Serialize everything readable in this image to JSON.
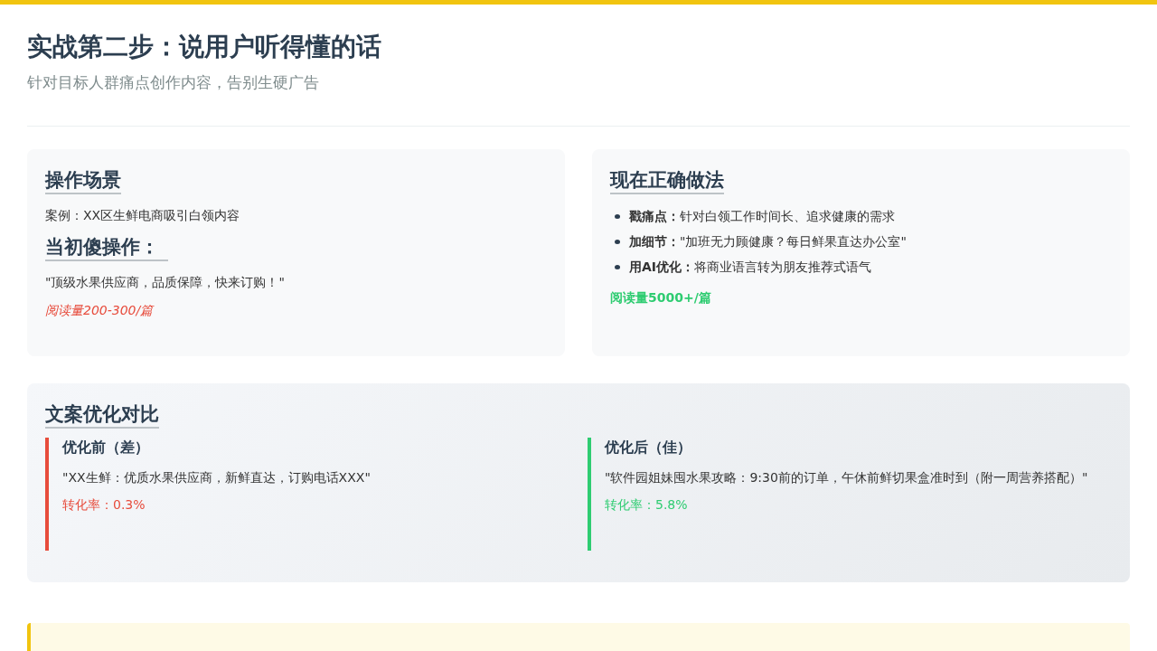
{
  "header": {
    "title": "实战第二步：说用户听得懂的话",
    "subtitle": "针对目标人群痛点创作内容，告别生硬广告"
  },
  "cards": [
    {
      "title": "操作场景",
      "blocks": [
        {
          "kind": "text",
          "text": "案例：XX区生鲜电商吸引白领内容"
        },
        {
          "kind": "heading",
          "text": "当初傻操作："
        },
        {
          "kind": "text",
          "text": "\"顶级水果供应商，品质保障，快来订购！\""
        },
        {
          "kind": "bad",
          "text": "阅读量200-300/篇"
        }
      ]
    },
    {
      "title": "现在正确做法",
      "blocks": [
        {
          "kind": "list",
          "items": [
            "**戳痛点：**针对白领工作时间长、追求健康的需求",
            "**加细节：**\"加班无力顾健康？每日鲜果直达办公室\"",
            "**用AI优化：**将商业语言转为朋友推荐式语气"
          ]
        },
        {
          "kind": "good",
          "text": "阅读量5000+/篇"
        }
      ]
    }
  ],
  "comparison": {
    "title": "文案优化对比",
    "items": [
      {
        "kind": "bad",
        "label": "优化前（差）",
        "copy": "\"XX生鲜：优质水果供应商，新鲜直达，订购电话XXX\"",
        "rate": "转化率：0.3%"
      },
      {
        "kind": "good",
        "label": "优化后（佳）",
        "copy": "\"软件园姐妹囤水果攻略：9:30前的订单，午休前鲜切果盒准时到（附一周营养搭配）\"",
        "rate": "转化率：5.8%"
      }
    ]
  }
}
